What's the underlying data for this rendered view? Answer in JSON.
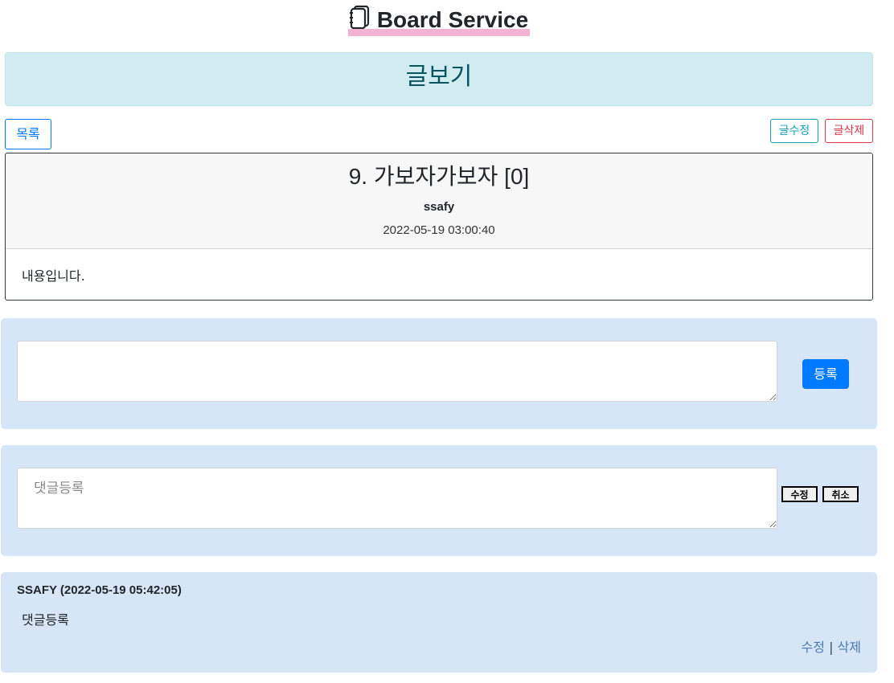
{
  "header": {
    "title": "Board Service",
    "icon": "notebook-icon"
  },
  "page_title": "글보기",
  "buttons": {
    "list": "목록",
    "edit": "글수정",
    "delete": "글삭제"
  },
  "article": {
    "no_title": "9. 가보자가보자",
    "comment_count": "[0]",
    "writer": "ssafy",
    "date": "2022-05-19 03:00:40",
    "content": "내용입니다."
  },
  "comment_form": {
    "value": "",
    "submit": "등록"
  },
  "comment_edit": {
    "placeholder": "댓글등록",
    "edit": "수정",
    "cancel": "취소"
  },
  "comments": [
    {
      "header": "SSAFY (2022-05-19 05:42:05)",
      "text": "댓글등록",
      "edit": "수정",
      "separator": "|",
      "delete": "삭제"
    }
  ],
  "colors": {
    "primary": "#007bff",
    "info": "#17a2b8",
    "danger": "#dc3545",
    "panel": "#d6e6f7"
  }
}
